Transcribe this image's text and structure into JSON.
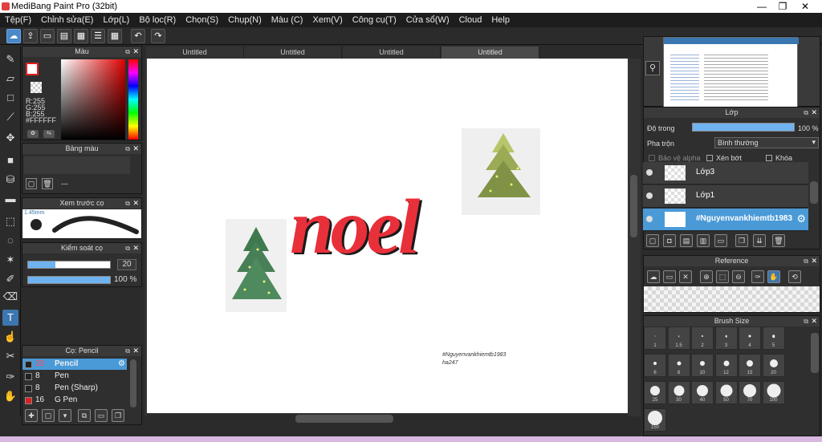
{
  "window": {
    "title": "MediBang Paint Pro (32bit)",
    "minimize": "—",
    "maximize": "❐",
    "close": "✕"
  },
  "menu": [
    "Tệp(F)",
    "Chỉnh sửa(E)",
    "Lớp(L)",
    "Bộ lọc(R)",
    "Chọn(S)",
    "Chụp(N)",
    "Màu (C)",
    "Xem(V)",
    "Công cụ(T)",
    "Cửa sổ(W)",
    "Cloud",
    "Help"
  ],
  "tabs": [
    "Untitled",
    "Untitled",
    "Untitled",
    "Untitled"
  ],
  "color_panel": {
    "title": "Màu",
    "r": "R:255",
    "g": "G:255",
    "b": "B:255",
    "hex": "#FFFFFF"
  },
  "palette_panel": {
    "title": "Bảng màu",
    "value": "---"
  },
  "brush_preview": {
    "title": "Xem trước cọ",
    "size": "1.45mm"
  },
  "brush_control": {
    "title": "Kiểm soát cọ",
    "size": "20",
    "opacity": "100 %",
    "size_fill": 0.33,
    "opacity_fill": 1.0
  },
  "brush_list": {
    "title": "Cọ: Pencil",
    "items": [
      {
        "size": "20",
        "name": "Pencil",
        "color": "#222222",
        "active": true
      },
      {
        "size": "8",
        "name": "Pen",
        "color": "#222222"
      },
      {
        "size": "8",
        "name": "Pen (Sharp)",
        "color": "#222222"
      },
      {
        "size": "16",
        "name": "G Pen",
        "color": "#e02020"
      }
    ]
  },
  "layer_panel": {
    "title": "Lớp",
    "opacity_label": "Độ trong",
    "opacity_value": "100 %",
    "blend_label": "Pha trộn",
    "blend_value": "Bình thường",
    "protect_alpha": "Bảo vệ alpha",
    "clipping": "Xén bớt",
    "lock": "Khóa",
    "layers": [
      "Lớp3",
      "Lớp1",
      "#Nguyenvankhiemtb1983"
    ]
  },
  "reference_panel": {
    "title": "Reference"
  },
  "brush_size_panel": {
    "title": "Brush Size",
    "sizes": [
      "1",
      "1.5",
      "2",
      "3",
      "4",
      "5",
      "6",
      "8",
      "10",
      "12",
      "15",
      "20",
      "25",
      "30",
      "40",
      "50",
      "70",
      "100",
      "150"
    ]
  },
  "canvas": {
    "title_text": "noel",
    "signature_line1": "#Nguyenvankhiemtb1983",
    "signature_line2": "ha247"
  },
  "colors": {
    "accent": "#3b76b0",
    "ui_bg": "#2b2b2b",
    "noel": "#e8303a"
  }
}
